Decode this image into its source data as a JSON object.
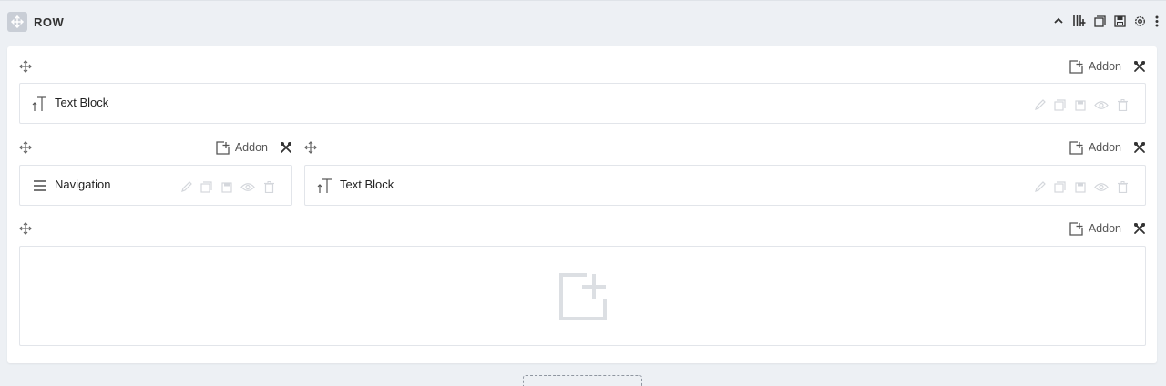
{
  "row": {
    "title": "ROW",
    "tools": [
      "collapse-icon",
      "columns-icon",
      "duplicate-icon",
      "save-icon",
      "settings-icon",
      "more-icon"
    ]
  },
  "columns": [
    {
      "addon_label": "Addon",
      "addons": [
        {
          "name": "Text Block",
          "icon": "text-block-icon"
        }
      ]
    },
    {
      "addon_label": "Addon",
      "addons": [
        {
          "name": "Navigation",
          "icon": "menu-icon"
        }
      ]
    },
    {
      "addon_label": "Addon",
      "addons": [
        {
          "name": "Text Block",
          "icon": "text-block-icon"
        }
      ]
    },
    {
      "addon_label": "Addon",
      "addons": []
    }
  ],
  "addon_actions": [
    "edit-icon",
    "duplicate-icon",
    "save-icon",
    "visibility-icon",
    "delete-icon"
  ],
  "colors": {
    "background": "#edf0f4",
    "panel": "#ffffff",
    "border": "#e2e5ea",
    "muted_icon": "#d4d7dc",
    "icon": "#555555"
  }
}
